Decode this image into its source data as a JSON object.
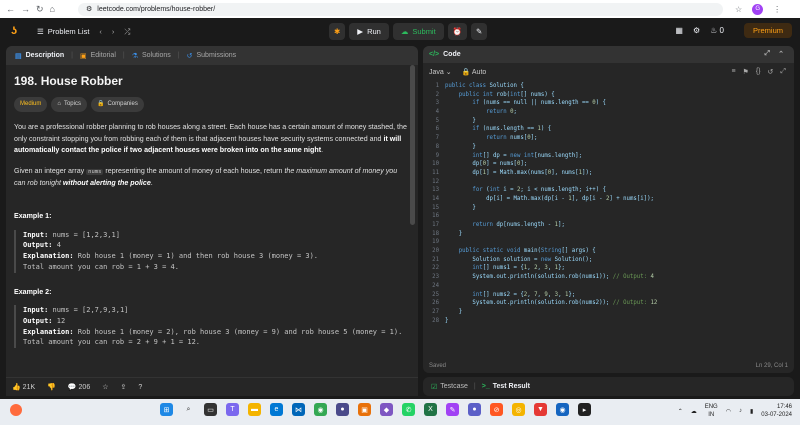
{
  "browser": {
    "url": "leetcode.com/problems/house-robber/",
    "avatar_letter": "G"
  },
  "topbar": {
    "problem_list": "Problem List",
    "run": "Run",
    "submit": "Submit",
    "fire_count": "0",
    "premium": "Premium"
  },
  "left_tabs": [
    "Description",
    "Editorial",
    "Solutions",
    "Submissions"
  ],
  "problem": {
    "title": "198. House Robber",
    "difficulty": "Medium",
    "topics": "Topics",
    "companies": "Companies",
    "p1_a": "You are a professional robber planning to rob houses along a street. Each house has a certain amount of money stashed, the only constraint stopping you from robbing each of them is that adjacent houses have security systems connected and ",
    "p1_b": "it will automatically contact the police if two adjacent houses were broken into on the same night",
    "p1_c": ".",
    "p2_a": "Given an integer array ",
    "p2_code": "nums",
    "p2_b": " representing the amount of money of each house, return ",
    "p2_c": "the maximum amount of money you can rob tonight ",
    "p2_d": "without alerting the police",
    "p2_e": ".",
    "ex1_title": "Example 1:",
    "ex1_input_label": "Input:",
    "ex1_input": " nums = [1,2,3,1]",
    "ex1_output_label": "Output:",
    "ex1_output": " 4",
    "ex1_expl_label": "Explanation:",
    "ex1_expl": " Rob house 1 (money = 1) and then rob house 3 (money = 3).",
    "ex1_total": "Total amount you can rob = 1 + 3 = 4.",
    "ex2_title": "Example 2:",
    "ex2_input_label": "Input:",
    "ex2_input": " nums = [2,7,9,3,1]",
    "ex2_output_label": "Output:",
    "ex2_output": " 12",
    "ex2_expl_label": "Explanation:",
    "ex2_expl": " Rob house 1 (money = 2), rob house 3 (money = 9) and rob house 5 (money = 1).",
    "ex2_total": "Total amount you can rob = 2 + 9 + 1 = 12."
  },
  "left_footer": {
    "likes": "21K",
    "comments": "206"
  },
  "code_panel": {
    "title": "Code",
    "language": "Java",
    "mode": "Auto",
    "status_left": "Saved",
    "status_right": "Ln 29, Col 1",
    "lines": [
      "public class Solution {",
      "    public int rob(int[] nums) {",
      "        if (nums == null || nums.length == 0) {",
      "            return 0;",
      "        }",
      "        if (nums.length == 1) {",
      "            return nums[0];",
      "        }",
      "        int[] dp = new int[nums.length];",
      "        dp[0] = nums[0];",
      "        dp[1] = Math.max(nums[0], nums[1]);",
      "",
      "        for (int i = 2; i < nums.length; i++) {",
      "            dp[i] = Math.max(dp[i - 1], dp[i - 2] + nums[i]);",
      "        }",
      "",
      "        return dp[nums.length - 1];",
      "    }",
      "",
      "    public static void main(String[] args) {",
      "        Solution solution = new Solution();",
      "        int[] nums1 = {1, 2, 3, 1};",
      "        System.out.println(solution.rob(nums1)); // Output: 4",
      "",
      "        int[] nums2 = {2, 7, 9, 3, 1};",
      "        System.out.println(solution.rob(nums2)); // Output: 12",
      "    }",
      "}"
    ]
  },
  "bottom_tabs": [
    "Testcase",
    "Test Result"
  ],
  "taskbar": {
    "lang": "ENG",
    "region": "IN",
    "time": "17:46",
    "date": "03-07-2024"
  }
}
